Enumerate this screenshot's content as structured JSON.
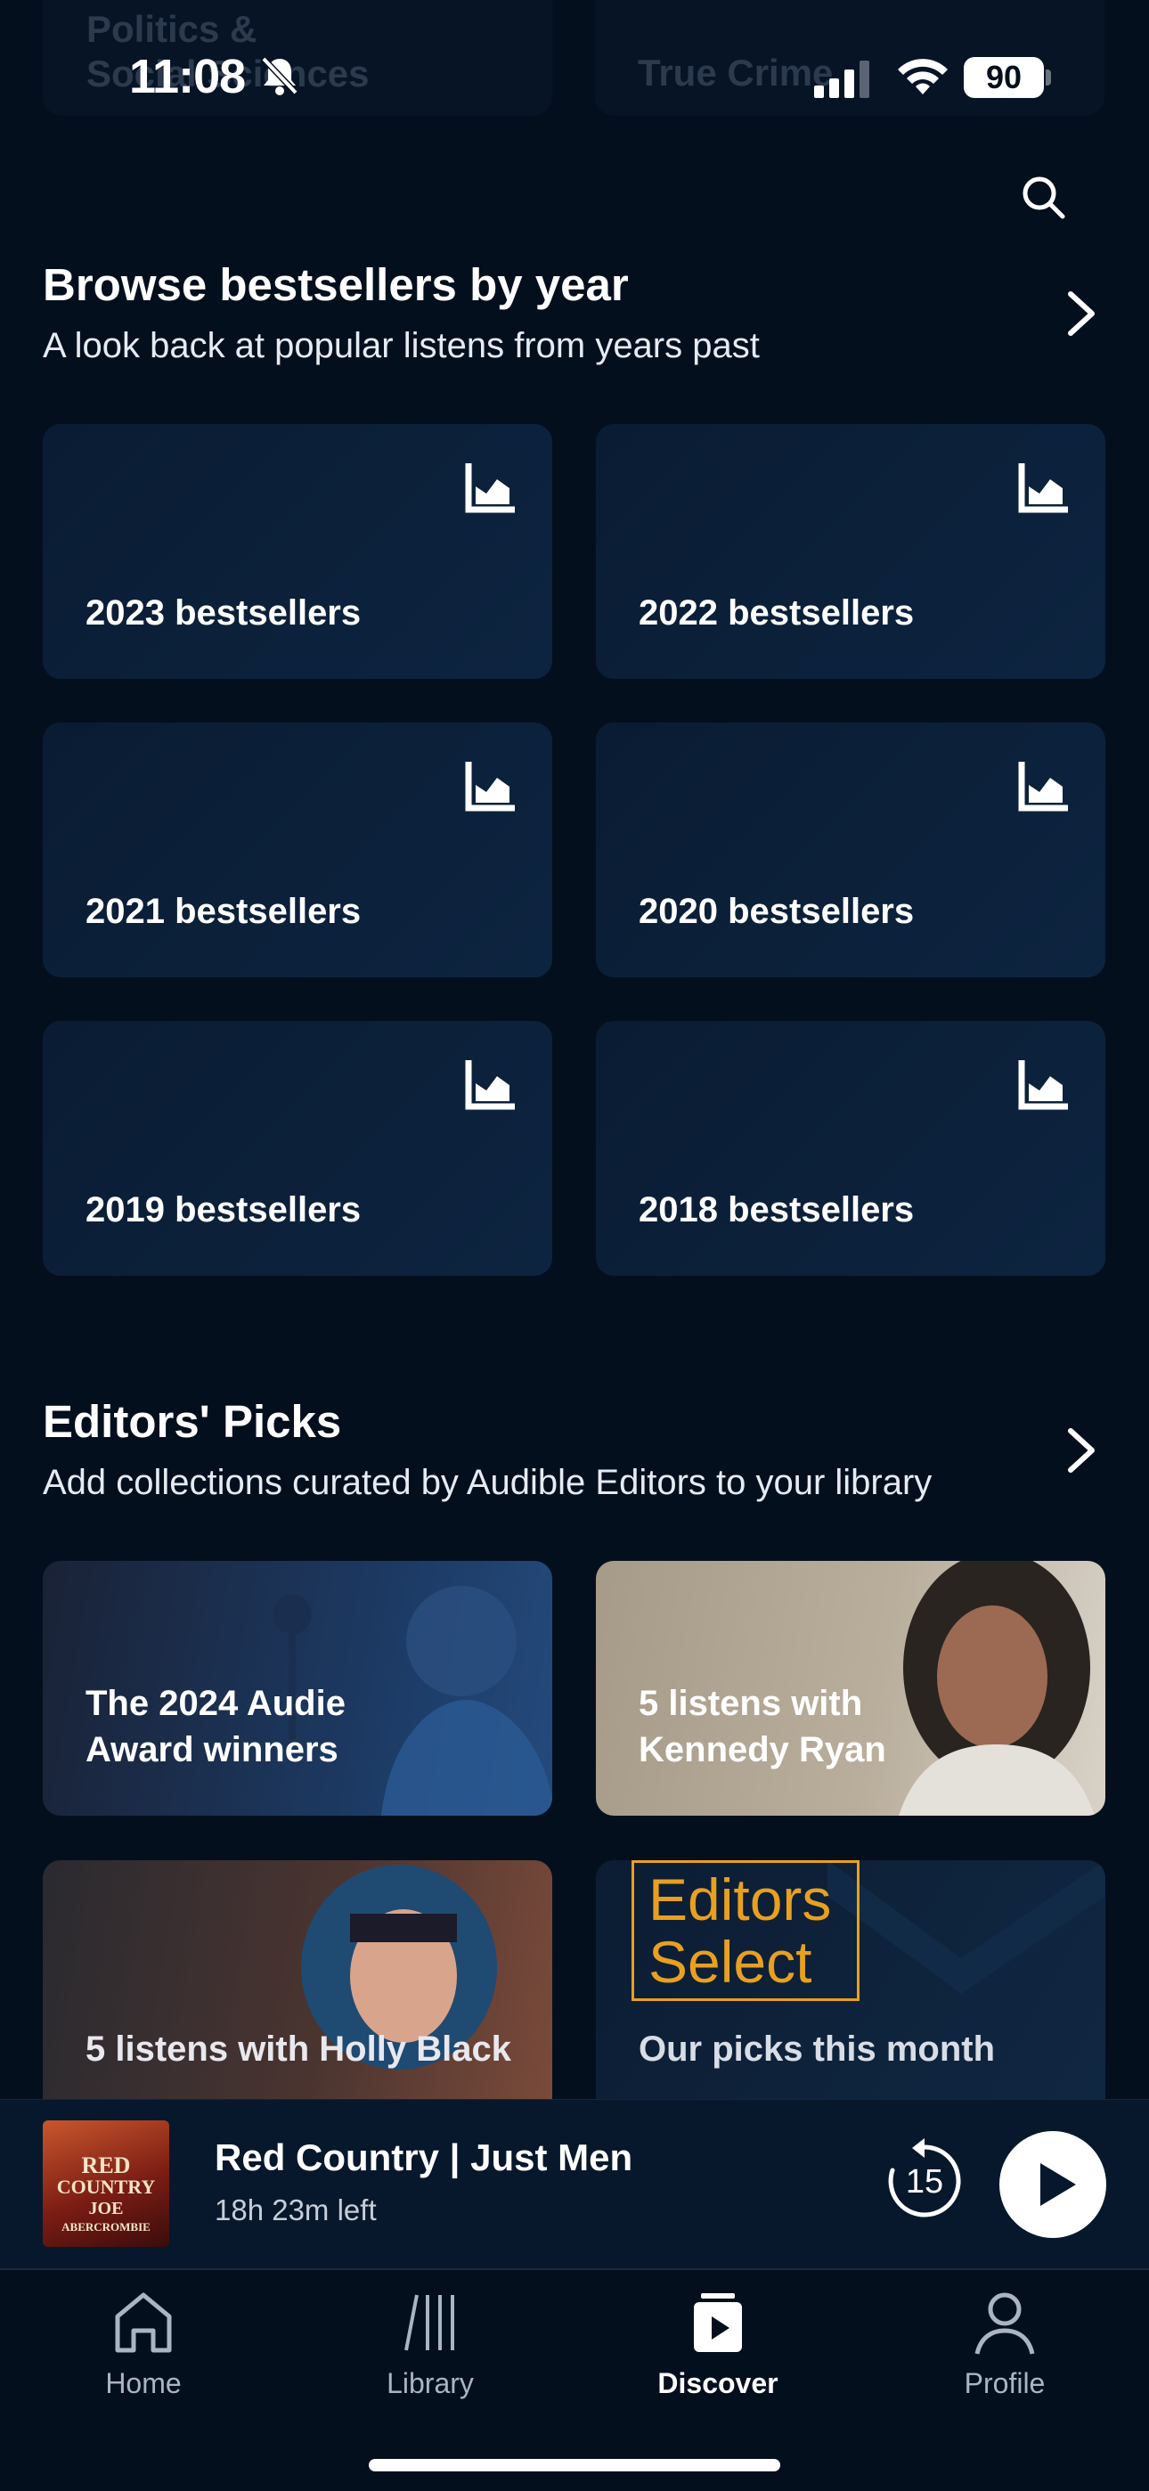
{
  "background_categories": [
    "Politics & Social Sciences",
    "True Crime"
  ],
  "status_bar": {
    "time": "11:08",
    "battery": "90"
  },
  "bestsellers": {
    "title": "Browse bestsellers by year",
    "subtitle": "A look back at popular listens from years past",
    "tiles": [
      {
        "label": "2023 bestsellers"
      },
      {
        "label": "2022 bestsellers"
      },
      {
        "label": "2021 bestsellers"
      },
      {
        "label": "2020 bestsellers"
      },
      {
        "label": "2019 bestsellers"
      },
      {
        "label": "2018 bestsellers"
      }
    ]
  },
  "editors_picks": {
    "title": "Editors' Picks",
    "subtitle": "Add collections curated by Audible Editors to your library",
    "tiles": [
      {
        "line1": "The 2024 Audie",
        "line2": "Award winners"
      },
      {
        "line1": "5 listens with",
        "line2": "Kennedy Ryan"
      },
      {
        "line1": "5 listens with Holly Black"
      },
      {
        "line1": "Our picks this month",
        "badge_line1": "Editors",
        "badge_line2": "Select"
      }
    ]
  },
  "player": {
    "title": "Red Country | Just Men",
    "time_left": "18h 23m left",
    "cover_line1": "RED",
    "cover_line2": "COUNTRY",
    "cover_line3": "JOE",
    "cover_line4": "ABERCROMBIE",
    "replay_seconds": "15"
  },
  "tabs": [
    {
      "label": "Home",
      "icon": "home-icon"
    },
    {
      "label": "Library",
      "icon": "library-icon"
    },
    {
      "label": "Discover",
      "icon": "discover-icon",
      "active": true
    },
    {
      "label": "Profile",
      "icon": "profile-icon"
    }
  ],
  "colors": {
    "background": "#040f1e",
    "tile": "#0a1c33",
    "editors_select_orange": "#e8a020"
  }
}
